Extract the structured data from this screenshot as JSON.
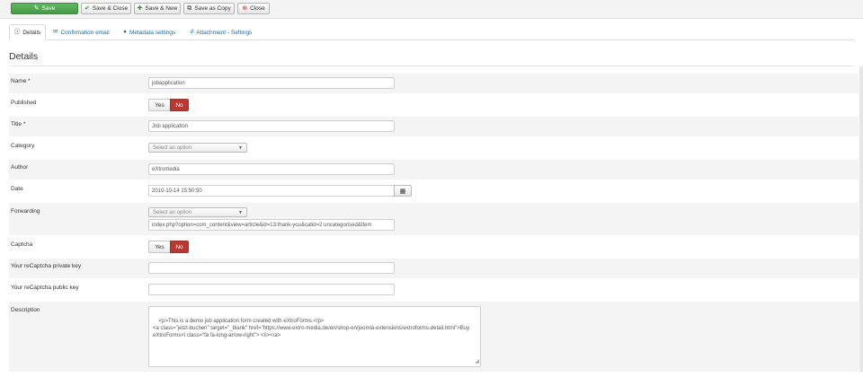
{
  "toolbar": {
    "save": "Save",
    "save_close": "Save & Close",
    "save_new": "Save & New",
    "save_copy": "Save as Copy",
    "close": "Close"
  },
  "tabs": [
    {
      "label": "Details",
      "icon": "info-icon"
    },
    {
      "label": "Confirmation email",
      "icon": "envelope-icon"
    },
    {
      "label": "Metadata settings",
      "icon": "pin-icon"
    },
    {
      "label": "Attachment - Settings",
      "icon": "paperclip-icon"
    }
  ],
  "section_title": "Details",
  "fields": {
    "name": {
      "label": "Name *",
      "value": "jobapplication"
    },
    "published": {
      "label": "Published",
      "yes": "Yes",
      "no": "No",
      "selected": "No"
    },
    "title": {
      "label": "Title *",
      "value": "Job application"
    },
    "category": {
      "label": "Category",
      "placeholder": "Select an option"
    },
    "author": {
      "label": "Author",
      "value": "eXtromedia"
    },
    "date": {
      "label": "Date",
      "value": "2010-10-14 15:50:50",
      "button_icon": "calendar-icon"
    },
    "forwarding": {
      "label": "Forwarding",
      "placeholder": "Select an option",
      "value": "index.php?option=com_content&view=article&id=13:thank-you&catid=2:uncategorised&Item"
    },
    "captcha": {
      "label": "Captcha",
      "yes": "Yes",
      "no": "No",
      "selected": "No"
    },
    "recaptcha_private": {
      "label": "Your reCaptcha private key",
      "value": ""
    },
    "recaptcha_public": {
      "label": "Your reCaptcha public key",
      "value": ""
    },
    "description": {
      "label": "Description",
      "value": "<p>This is a demo job application form created with eXtroForms.</p>\n<a class=\"jetzt-buchen\" target=\"_blank\" href=\"https://www.extro-media.de/en/shop-en/joomla-extensions/extroforms-detail.html\">Buy eXtroForms<i class=\"fa fa-long-arrow-right\"> </i></a>"
    }
  },
  "colors": {
    "save_green": "#51a351",
    "toggle_no_red": "#bd362f",
    "link_blue": "#1b6fad"
  }
}
